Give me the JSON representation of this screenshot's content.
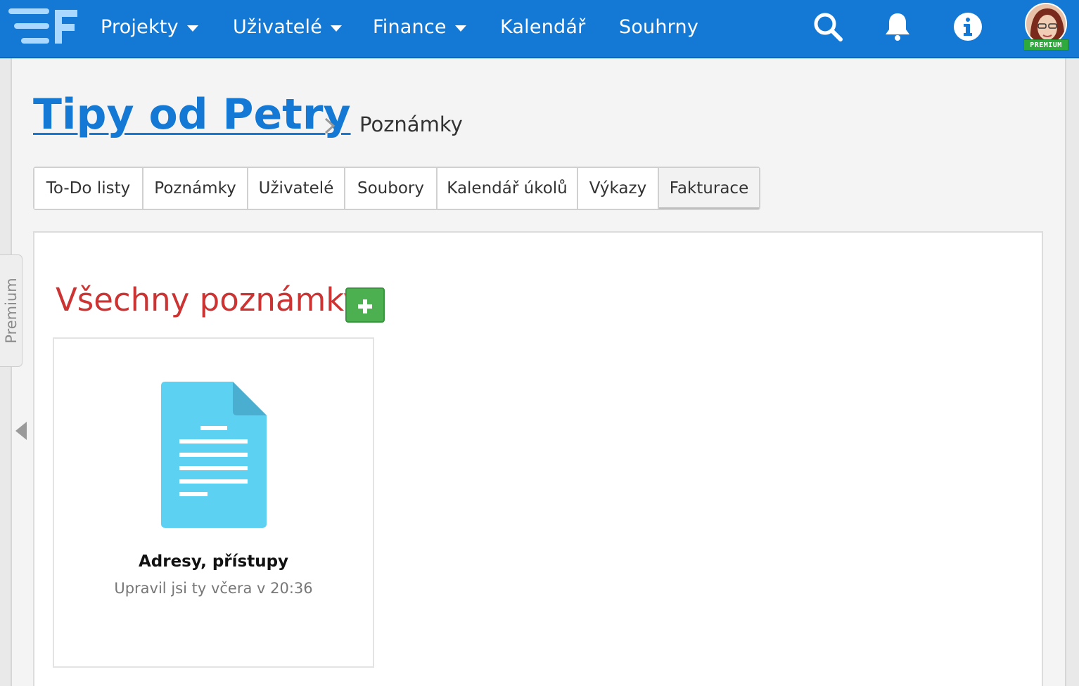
{
  "nav": {
    "items": [
      {
        "label": "Projekty",
        "dropdown": true
      },
      {
        "label": "Uživatelé",
        "dropdown": true
      },
      {
        "label": "Finance",
        "dropdown": true
      },
      {
        "label": "Kalendář",
        "dropdown": false
      },
      {
        "label": "Souhrny",
        "dropdown": false
      }
    ],
    "icons": [
      "search-icon",
      "bell-icon",
      "info-icon"
    ],
    "avatar_badge": "PREMIUM",
    "colors": {
      "bar": "#1479d4",
      "badge": "#2eaa3c"
    }
  },
  "sidebar": {
    "tab_label": "Premium"
  },
  "breadcrumb": {
    "project": "Tipy od Petry",
    "current": "Poznámky"
  },
  "tabs": [
    {
      "label": "To-Do listy"
    },
    {
      "label": "Poznámky"
    },
    {
      "label": "Uživatelé"
    },
    {
      "label": "Soubory"
    },
    {
      "label": "Kalendář úkolů"
    },
    {
      "label": "Výkazy"
    },
    {
      "label": "Fakturace",
      "active": true
    }
  ],
  "notes": {
    "title": "Všechny poznámky",
    "title_color": "#cc3333",
    "items": [
      {
        "title": "Adresy, přístupy",
        "meta": "Upravil jsi ty včera v 20:36",
        "icon": "document-icon"
      }
    ]
  }
}
